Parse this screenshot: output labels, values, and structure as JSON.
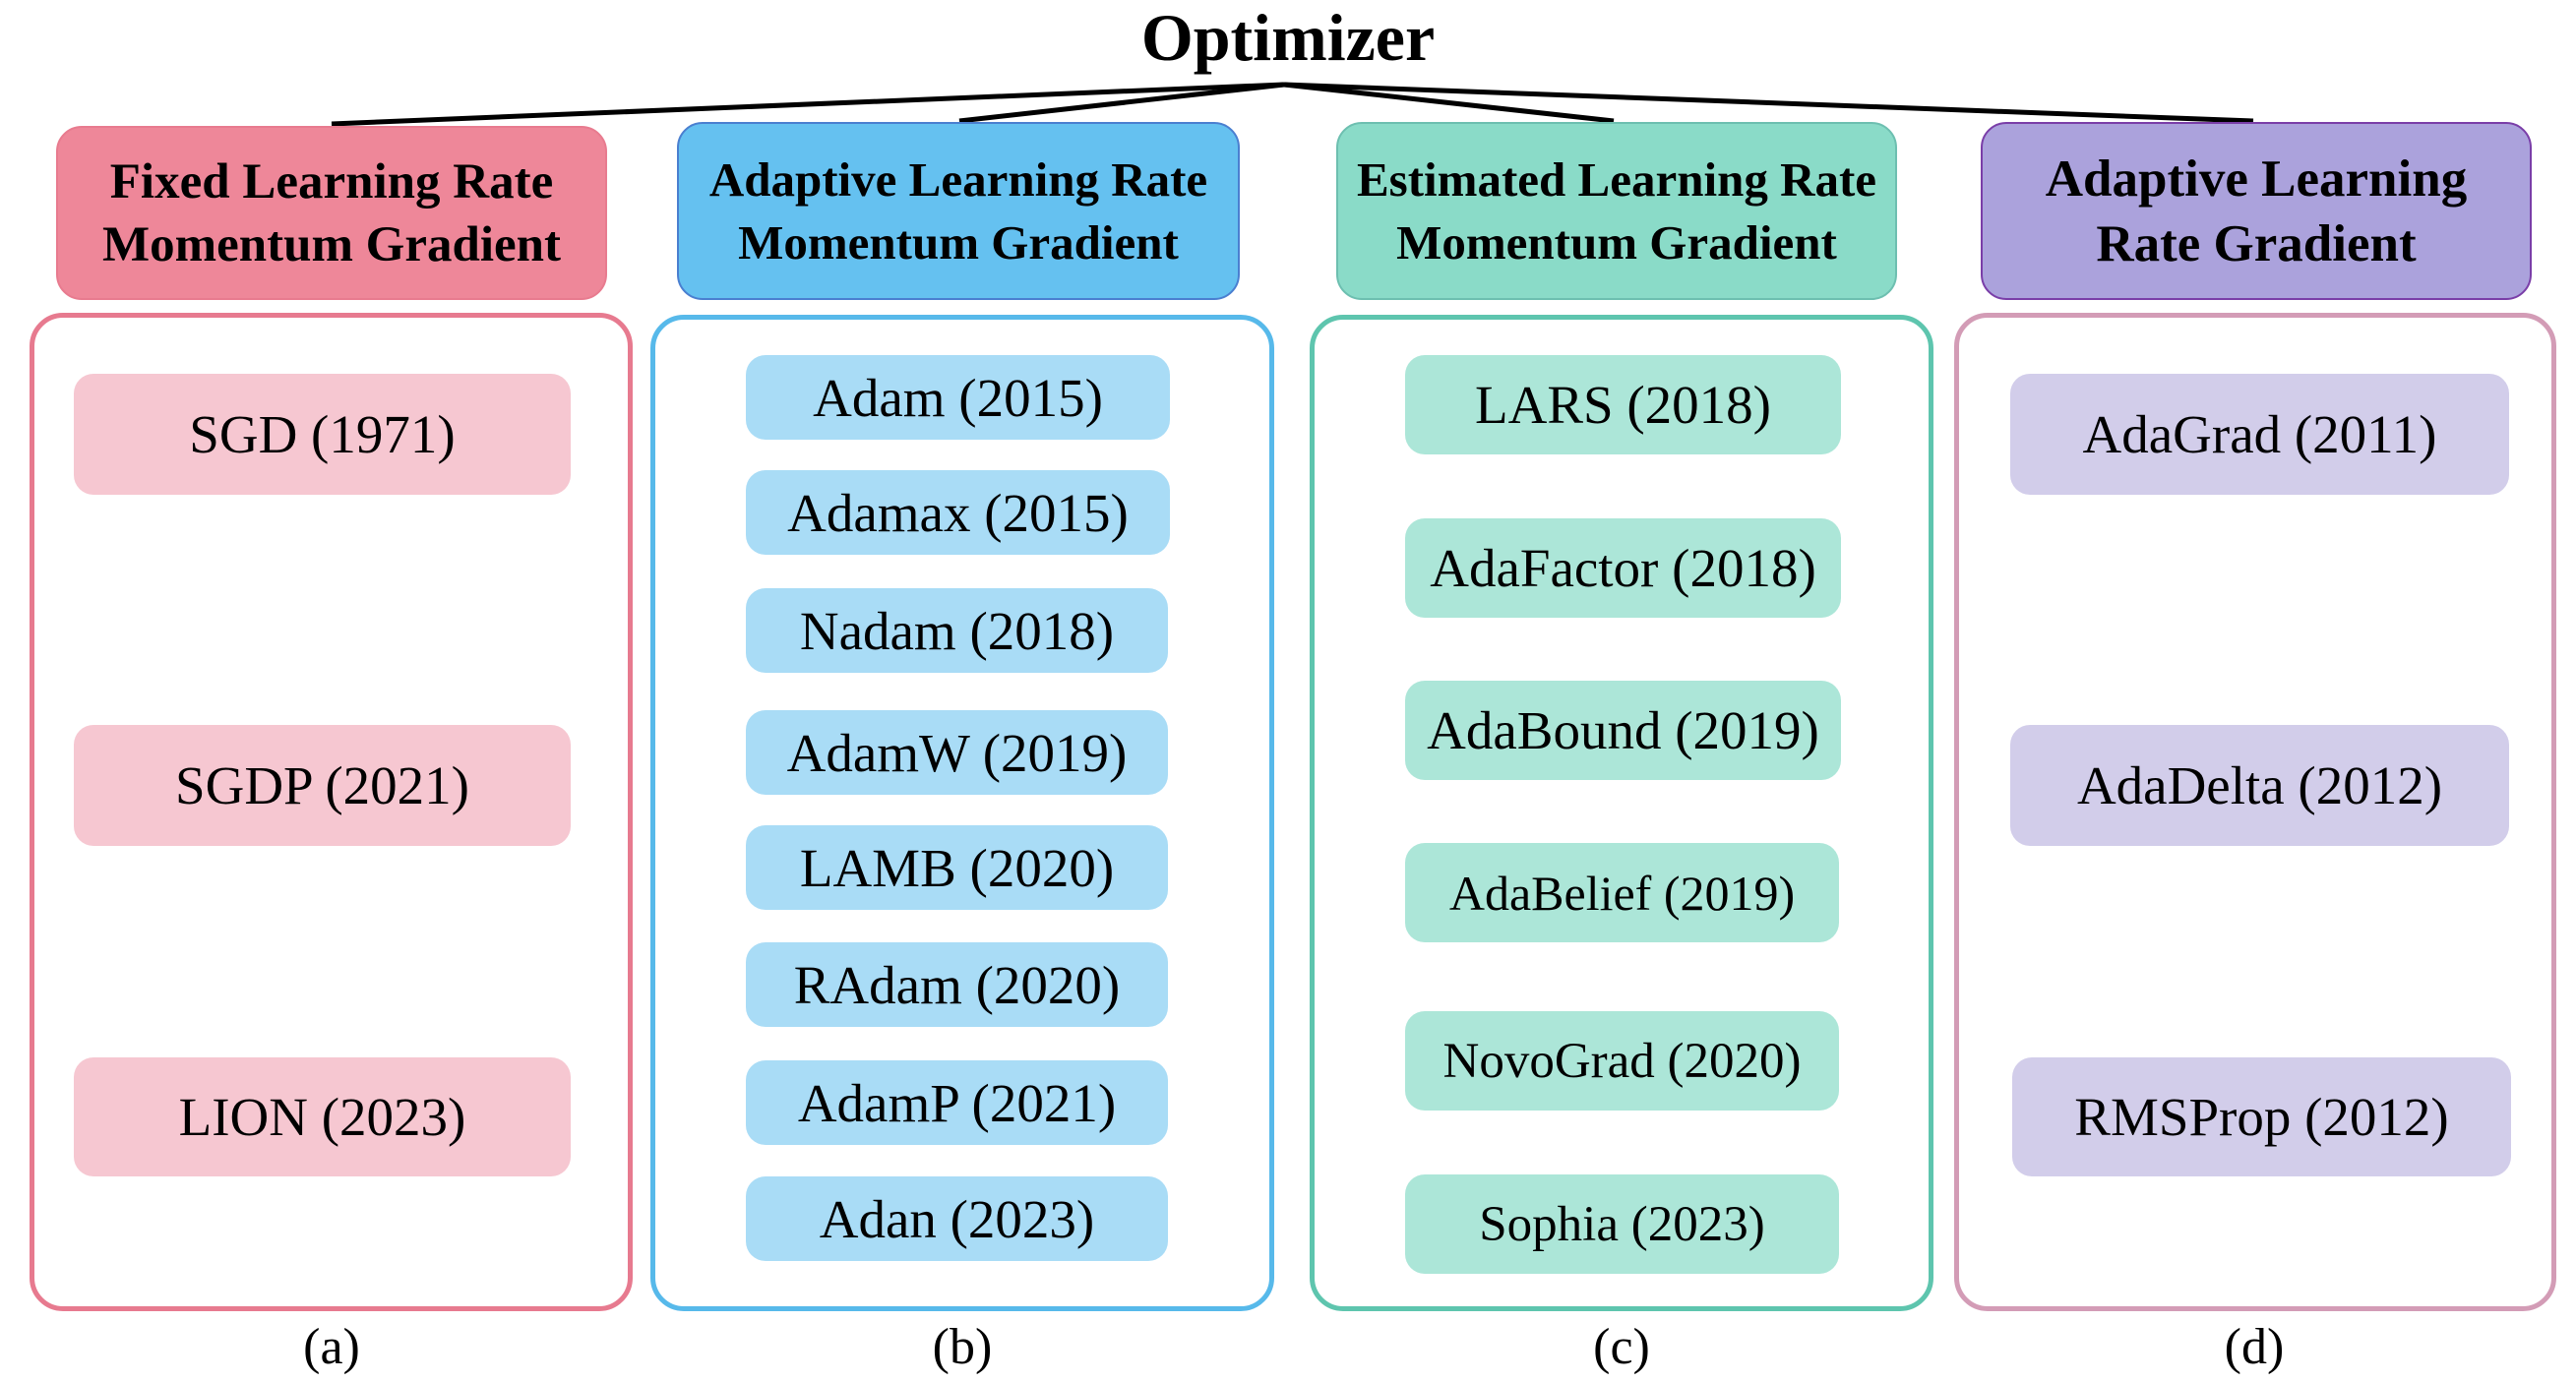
{
  "title": "Optimizer",
  "colors": {
    "fixed_header": "#ee8799",
    "fixed_panel_border": "#e77a8f",
    "fixed_item": "#f6c7d1",
    "adaptive_mom_header": "#65c1f0",
    "adaptive_mom_panel_border": "#57b9ea",
    "adaptive_mom_item": "#a9dcf6",
    "estimated_header": "#8adbc8",
    "estimated_panel_border": "#5ec5ae",
    "estimated_item": "#ace6d8",
    "adaptive_grad_header": "#aba2dc",
    "adaptive_grad_panel_border": "#d39cb6",
    "adaptive_grad_item": "#d2cdea"
  },
  "categories": [
    {
      "header_line1": "Fixed Learning Rate",
      "header_line2": "Momentum Gradient",
      "caption": "(a)",
      "optimizers": [
        "SGD (1971)",
        "SGDP (2021)",
        "LION (2023)"
      ]
    },
    {
      "header_line1": "Adaptive Learning Rate",
      "header_line2": "Momentum Gradient",
      "caption": "(b)",
      "optimizers": [
        "Adam (2015)",
        "Adamax (2015)",
        "Nadam (2018)",
        "AdamW (2019)",
        "LAMB (2020)",
        "RAdam (2020)",
        "AdamP (2021)",
        "Adan (2023)"
      ]
    },
    {
      "header_line1": "Estimated Learning Rate",
      "header_line2": "Momentum Gradient",
      "caption": "(c)",
      "optimizers": [
        "LARS (2018)",
        "AdaFactor (2018)",
        "AdaBound (2019)",
        "AdaBelief (2019)",
        "NovoGrad (2020)",
        "Sophia (2023)"
      ]
    },
    {
      "header_line1": "Adaptive Learning",
      "header_line2": "Rate Gradient",
      "caption": "(d)",
      "optimizers": [
        "AdaGrad (2011)",
        "AdaDelta (2012)",
        "RMSProp (2012)"
      ]
    }
  ]
}
